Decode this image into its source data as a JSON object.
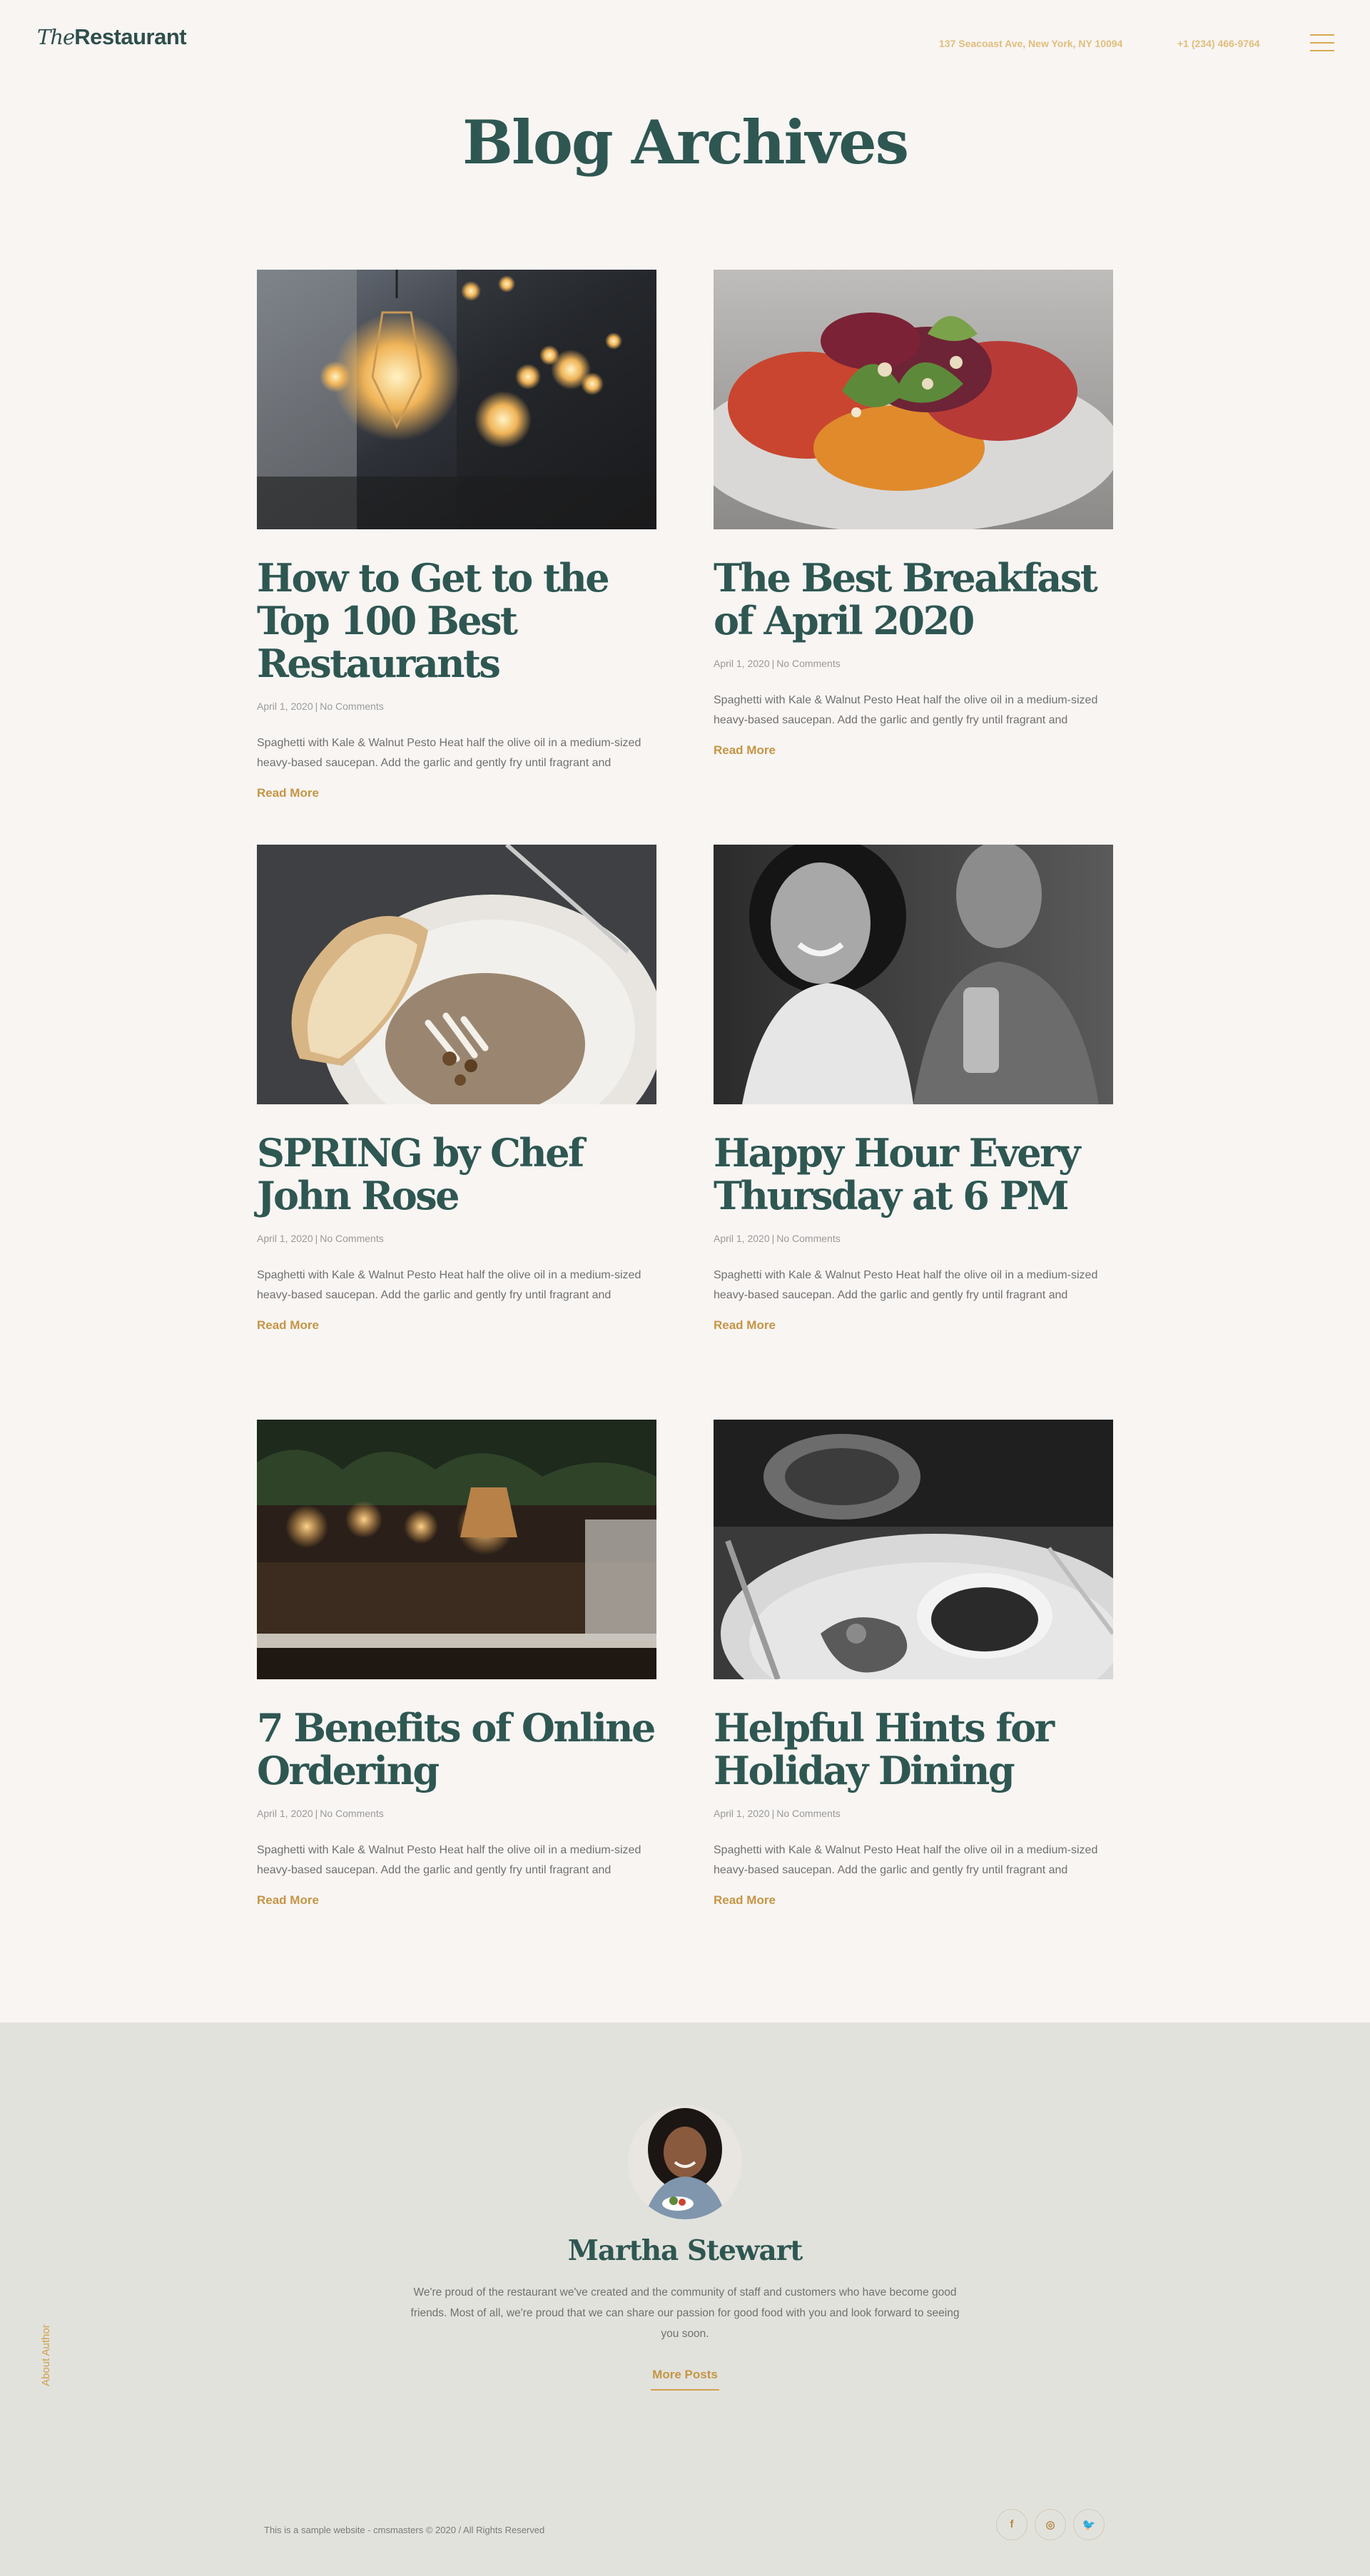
{
  "header": {
    "logo_the": "The",
    "logo_restaurant": "Restaurant",
    "address": "137 Seacoast Ave, New York, NY 10094",
    "phone": "+1 (234) 466-9764",
    "menu_icon": "hamburger-menu-icon"
  },
  "page_title": "Blog Archives",
  "posts": [
    {
      "title": "How to Get to the Top 100 Best Restaurants",
      "date": "April 1, 2020",
      "separator": "|",
      "comments": "No Comments",
      "excerpt": "Spaghetti with Kale & Walnut Pesto Heat half the olive oil in a medium-sized heavy-based saucepan. Add the garlic and gently fry until fragrant and",
      "read_more": "Read More",
      "image": "restaurant-interior-hanging-lamp-photo"
    },
    {
      "title": "The Best Breakfast of April 2020",
      "date": "April 1, 2020",
      "separator": "|",
      "comments": "No Comments",
      "excerpt": "Spaghetti with Kale & Walnut Pesto Heat half the olive oil in a medium-sized heavy-based saucepan. Add the garlic and gently fry until fragrant and",
      "read_more": "Read More",
      "image": "salad-dish-photo"
    },
    {
      "title": "SPRING by Chef John Rose",
      "date": "April 1, 2020",
      "separator": "|",
      "comments": "No Comments",
      "excerpt": "Spaghetti with Kale & Walnut Pesto Heat half the olive oil in a medium-sized heavy-based saucepan. Add the garlic and gently fry until fragrant and",
      "read_more": "Read More",
      "image": "soup-with-bread-photo"
    },
    {
      "title": "Happy Hour Every Thursday at 6 PM",
      "date": "April 1, 2020",
      "separator": "|",
      "comments": "No Comments",
      "excerpt": "Spaghetti with Kale & Walnut Pesto Heat half the olive oil in a medium-sized heavy-based saucepan. Add the garlic and gently fry until fragrant and",
      "read_more": "Read More",
      "image": "smiling-couple-photo"
    },
    {
      "title": "7 Benefits of Online Ordering",
      "date": "April 1, 2020",
      "separator": "|",
      "comments": "No Comments",
      "excerpt": "Spaghetti with Kale & Walnut Pesto Heat half the olive oil in a medium-sized heavy-based saucepan. Add the garlic and gently fry until fragrant and",
      "read_more": "Read More",
      "image": "bar-interior-photo"
    },
    {
      "title": "Helpful Hints for Holiday Dining",
      "date": "April 1, 2020",
      "separator": "|",
      "comments": "No Comments",
      "excerpt": "Spaghetti with Kale & Walnut Pesto Heat half the olive oil in a medium-sized heavy-based saucepan. Add the garlic and gently fry until fragrant and",
      "read_more": "Read More",
      "image": "plated-dish-photo"
    }
  ],
  "author": {
    "section_label": "About Author",
    "name": "Martha Stewart",
    "bio": "We're proud of the restaurant we've created and the community of staff and customers who have become good friends. Most of all, we're proud that we can share our passion for good food with you and look forward to seeing you soon.",
    "more_posts": "More Posts"
  },
  "footer": {
    "copyright": "This is a sample website - cmsmasters © 2020 / All Rights Reserved",
    "social": [
      {
        "icon": "facebook-icon",
        "glyph": "f"
      },
      {
        "icon": "instagram-icon",
        "glyph": "◎"
      },
      {
        "icon": "twitter-icon",
        "glyph": "🐦"
      }
    ]
  },
  "colors": {
    "background": "#f8f5f3",
    "heading": "#2f5752",
    "accent": "#c59545",
    "footer_bg": "#e2e2dd"
  }
}
